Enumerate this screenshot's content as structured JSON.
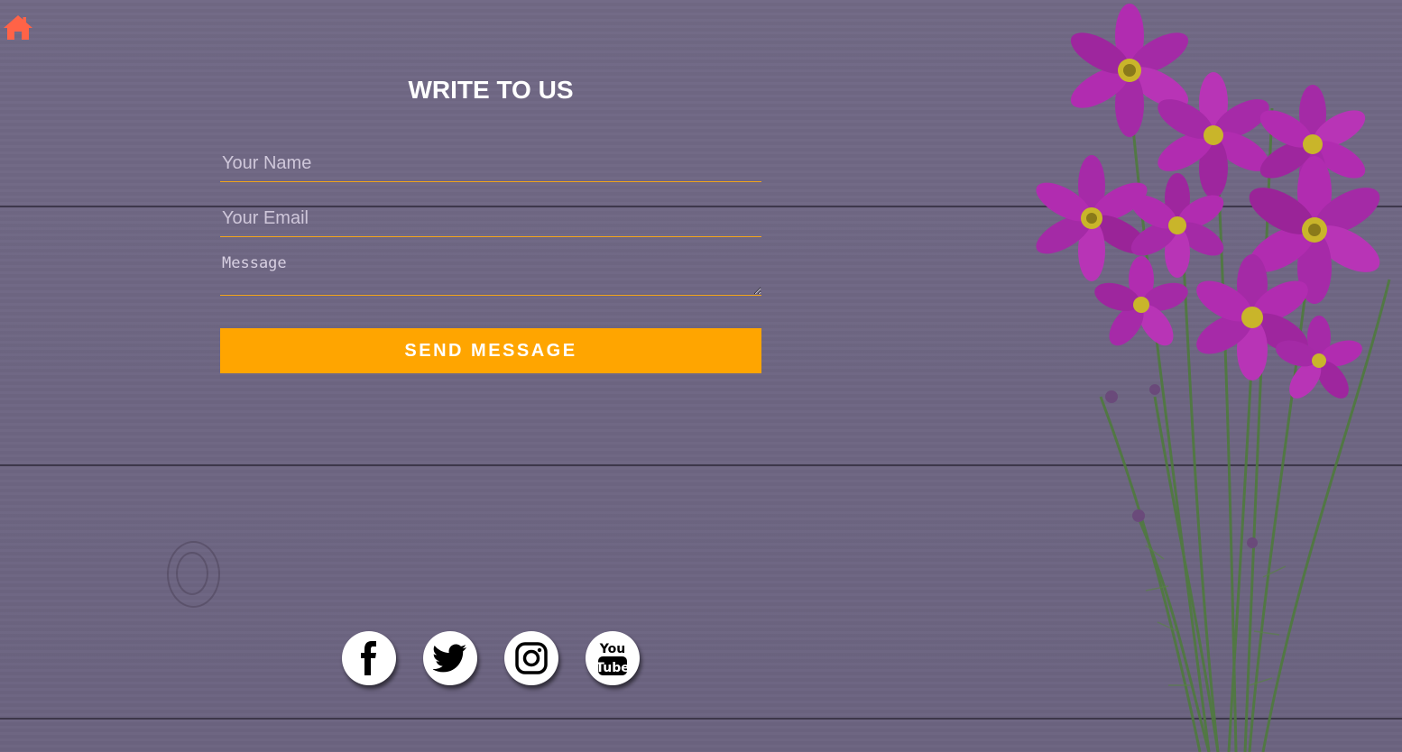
{
  "page": {
    "title": "WRITE TO US"
  },
  "nav": {
    "home_icon": "home-icon"
  },
  "form": {
    "name_placeholder": "Your Name",
    "email_placeholder": "Your Email",
    "message_placeholder": "Message",
    "submit_label": "SEND MESSAGE"
  },
  "social": [
    {
      "name": "facebook",
      "icon": "facebook-icon"
    },
    {
      "name": "twitter",
      "icon": "twitter-icon"
    },
    {
      "name": "instagram",
      "icon": "instagram-icon"
    },
    {
      "name": "youtube",
      "icon": "youtube-icon"
    }
  ],
  "colors": {
    "accent": "#ffa500",
    "home_icon": "#ff6347",
    "background": "#6e6683",
    "flower": "#b12cb0"
  }
}
